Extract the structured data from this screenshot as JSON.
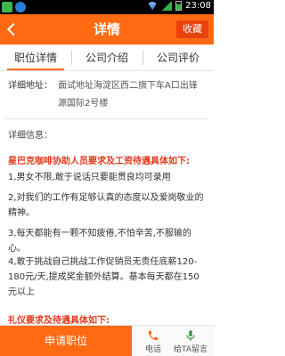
{
  "status": {
    "time": "23:08"
  },
  "header": {
    "title": "详情",
    "collect_label": "收藏"
  },
  "tabs": [
    {
      "label": "职位详情",
      "active": true
    },
    {
      "label": "公司介绍",
      "active": false
    },
    {
      "label": "公司评价",
      "active": false
    }
  ],
  "address": {
    "label": "详细地址：",
    "value": "面试地址海淀区西二旗下车A口出锋 源国际2号楼"
  },
  "detail": {
    "label": "详细信息：",
    "section1_title": "星巴克咖啡协助人员要求及工资待遇具体如下:",
    "p1": "1,男女不限,敢于说话只要能贯良均可录用",
    "p2": "2,对我们的工作有足够认真的态度以及爱岗敬业的精神。",
    "p3": "3,每天都能有一颗不知疲倦,不怕辛苦,不服输的心。",
    "p4": "4,敢于挑战自己挑战工作促销员无责任底薪120-180元/天,提成奖金额外结算。基本每天都在150元以上",
    "section2_title": "礼仪要求及待遇具体如下:"
  },
  "bottom": {
    "apply_label": "申请职位",
    "phone_label": "电话",
    "voice_label": "给TA留言"
  },
  "colors": {
    "accent": "#ff6a13",
    "section_red": "#e23a1d"
  }
}
